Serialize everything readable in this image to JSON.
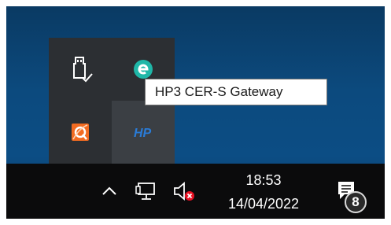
{
  "tray": {
    "icons": [
      "usb-eject-icon",
      "eset-icon",
      "quickaccess-app-icon",
      "hp-icon"
    ],
    "tooltip": "HP3 CER-S Gateway"
  },
  "taskbar": {
    "icons": [
      "show-hidden-icons-chevron-icon",
      "network-icon",
      "speaker-muted-icon",
      "notifications-icon"
    ],
    "time": "18:53",
    "date": "14/04/2022",
    "notification_count": "8"
  },
  "colors": {
    "desktop": "#0c4a7e",
    "taskbar": "#0b0b0c",
    "flyout": "#2c2f33",
    "muted_badge": "#e81123",
    "eset_teal": "#1fb7a8",
    "hp_blue": "#2a7bd6",
    "orange_app": "#f26b21"
  }
}
